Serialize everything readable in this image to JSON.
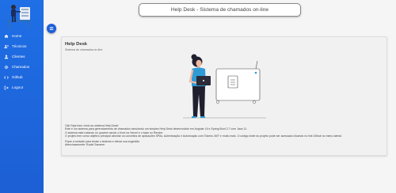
{
  "header": {
    "title": "Help Desk - Sistema de chamados on-line"
  },
  "sidebar": {
    "items": [
      {
        "label": "Home",
        "icon": "home-icon"
      },
      {
        "label": "Técnicos",
        "icon": "engineering-icon"
      },
      {
        "label": "Clientes",
        "icon": "person-icon"
      },
      {
        "label": "Chamados",
        "icon": "gear-icon"
      },
      {
        "label": "Github",
        "icon": "code-icon"
      },
      {
        "label": "Logout",
        "icon": "logout-icon"
      }
    ],
    "toggle_icon": "menu-icon"
  },
  "card": {
    "title": "Help Desk",
    "subtitle": "Sistema de chamados on-line",
    "description_lines": [
      "Olá! Seja bem vindo ao sistema Help Desk!",
      "Este é um sistema para gerenciamento de chamados simulando um simples Help Desk desenvolvido em Angular 16 e Spring Boot 2.7 com Java 11.",
      "O sistema está rodando no quarem sendo o front na Vercel e o back no Render.",
      "O projeto tem como objetivo principal abordar os conceitos de aplicações SPAs, Autenticação e Autorização com Tokens JWT e muito mais. O código fonte do projeto pode ser acessado clicando no link Github no menu lateral.",
      "Fique a vontade para testar o sistema e deixar sua sugestão.",
      "Atenciosamente: Rudel Sammer"
    ]
  },
  "colors": {
    "sidebar": "#1f6fe6",
    "accent_blue": "#1e5fd8",
    "shirt": "#2e9bd6"
  }
}
